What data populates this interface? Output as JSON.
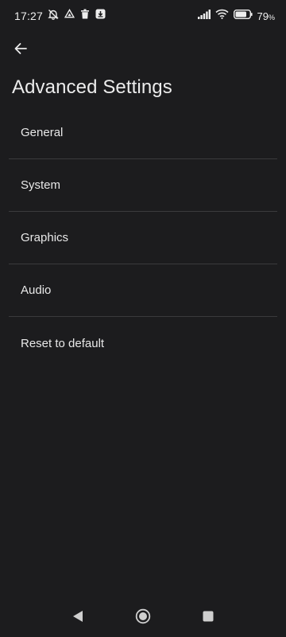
{
  "status_bar": {
    "time": "17:27",
    "battery_percent": "79",
    "battery_unit": "%",
    "left_icons": [
      "notifications-off-icon",
      "drive-icon",
      "trash-icon",
      "download-app-icon"
    ],
    "right_icons": [
      "signal-icon",
      "wifi-icon",
      "battery-icon"
    ]
  },
  "header": {
    "back_icon": "arrow-left-icon",
    "title": "Advanced Settings"
  },
  "settings": {
    "items": [
      {
        "label": "General"
      },
      {
        "label": "System"
      },
      {
        "label": "Graphics"
      },
      {
        "label": "Audio"
      },
      {
        "label": "Reset to default"
      }
    ]
  },
  "nav_bar": {
    "icons": [
      "back-triangle-icon",
      "home-circle-icon",
      "recents-square-icon"
    ]
  },
  "colors": {
    "background": "#1c1c1e",
    "divider": "#3a3a3c",
    "text": "#e8e8e8"
  }
}
